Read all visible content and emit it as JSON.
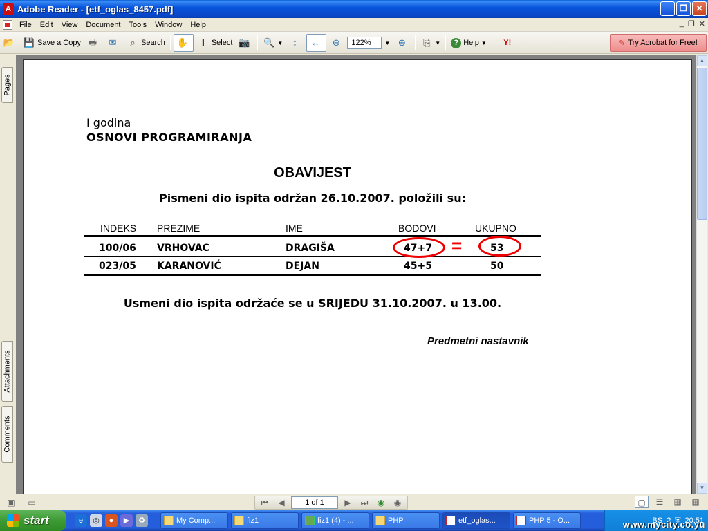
{
  "window": {
    "title": "Adobe Reader - [etf_oglas_8457.pdf]",
    "app_icon": "acrobat-icon",
    "buttons": [
      "_",
      "❐",
      "✕"
    ]
  },
  "menu": {
    "items": [
      "File",
      "Edit",
      "View",
      "Document",
      "Tools",
      "Window",
      "Help"
    ],
    "mdi_buttons": [
      "_",
      "❐",
      "✕"
    ]
  },
  "toolbar": {
    "save_copy": "Save a Copy",
    "search": "Search",
    "select": "Select",
    "zoom": "122%",
    "help": "Help",
    "try_acrobat": "Try Acrobat for Free!"
  },
  "side_tabs": {
    "pages": "Pages",
    "attachments": "Attachments",
    "comments": "Comments"
  },
  "document": {
    "year": "I godina",
    "course": "OSNOVI PROGRAMIRANJA",
    "heading": "OBAVIJEST",
    "subheading": "Pismeni dio ispita održan 26.10.2007. položili su:",
    "table": {
      "headers": [
        "INDEKS",
        "PREZIME",
        "IME",
        "BODOVI",
        "UKUPNO"
      ],
      "rows": [
        [
          "100/06",
          "VRHOVAC",
          "DRAGIŠA",
          "47+7",
          "53"
        ],
        [
          "023/05",
          "KARANOVIĆ",
          "DEJAN",
          "45+5",
          "50"
        ]
      ]
    },
    "oral_exam": "Usmeni dio ispita održaće se u SRIJEDU 31.10.2007. u 13.00.",
    "signature": "Predmetni nastavnik",
    "annotation_equals": "="
  },
  "status": {
    "page_indicator": "1 of 1"
  },
  "taskbar": {
    "start": "start",
    "tasks": [
      "My Comp...",
      "fiz1",
      "fiz1 (4) - ...",
      "PHP",
      "etf_oglas...",
      "PHP 5 - O..."
    ],
    "tray_lang": "BS",
    "clock": "20:51",
    "watermark": "www.mycity.co.yu"
  },
  "colors": {
    "annotation_red": "#e00000",
    "title_blue": "#0855dd",
    "taskbar_blue": "#245edb",
    "start_green": "#3d9a33"
  }
}
